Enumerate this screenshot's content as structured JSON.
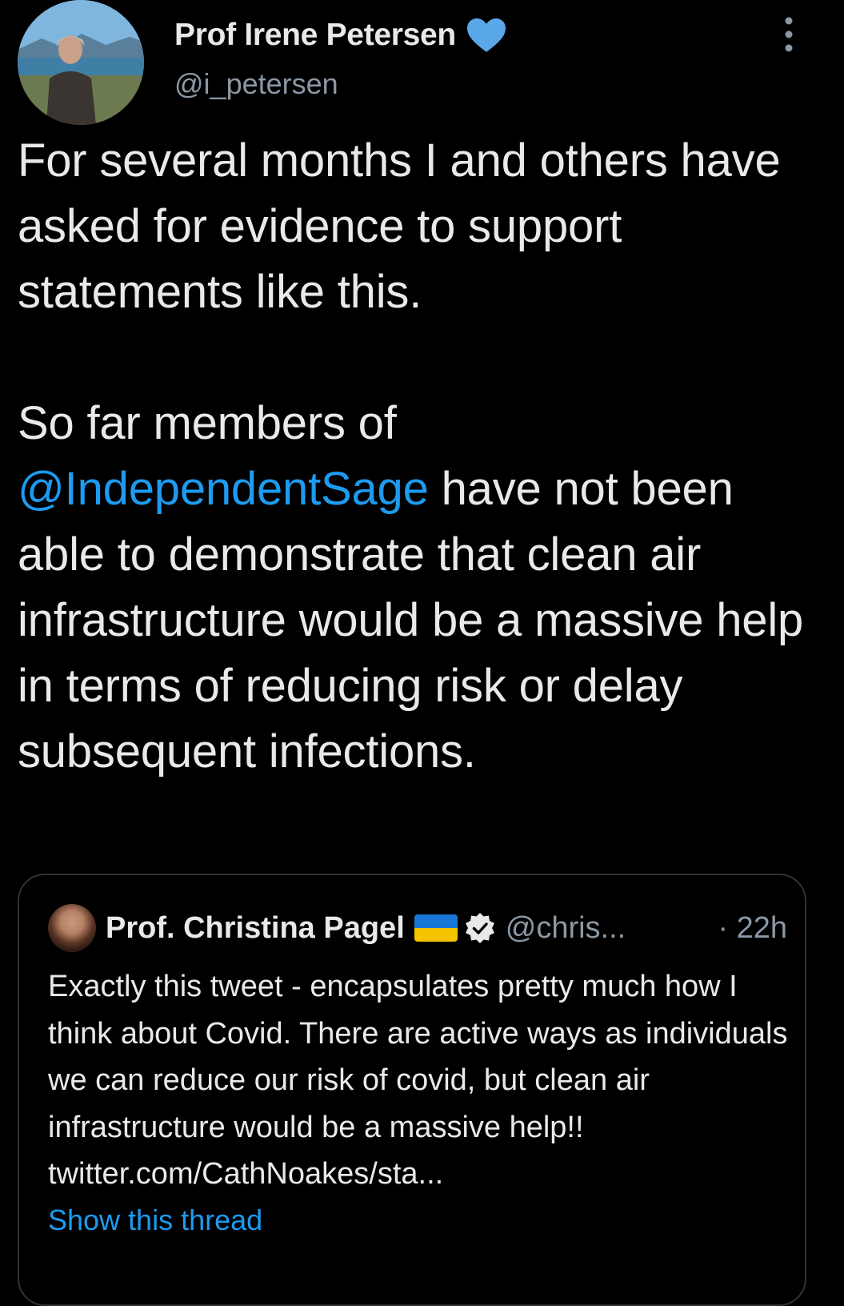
{
  "tweet": {
    "author": {
      "name": "Prof Irene Petersen",
      "handle": "@i_petersen",
      "verified_color": "#1d9bf0"
    },
    "paragraph_1": "For several months I and others have asked for evidence to support statements like this.",
    "paragraph_2": {
      "before": "So far members of ",
      "mention": "@IndependentSage",
      "after": " have not been able to demonstrate that clean air infrastructure would be a massive help in terms of reducing risk or delay subsequent infections."
    }
  },
  "quoted_tweet": {
    "author_name": "Prof. Christina Pagel",
    "flag": "ukraine-flag",
    "handle": "@chris...",
    "time": "· 22h",
    "text": "Exactly this tweet - encapsulates pretty much how I think about Covid. There are active ways as individuals we can reduce our risk of covid, but clean air infrastructure would be a massive help!! twitter.com/CathNoakes/sta...",
    "show_thread_label": "Show this thread"
  },
  "icons": {
    "more": "more-vertical-icon",
    "verified_blue": "heart-icon",
    "verified_gray": "verified-badge-icon"
  },
  "colors": {
    "background": "#000000",
    "text": "#e7e9ea",
    "secondary_text": "#8b98a5",
    "link": "#1d9bf0",
    "border": "#2f3336"
  }
}
